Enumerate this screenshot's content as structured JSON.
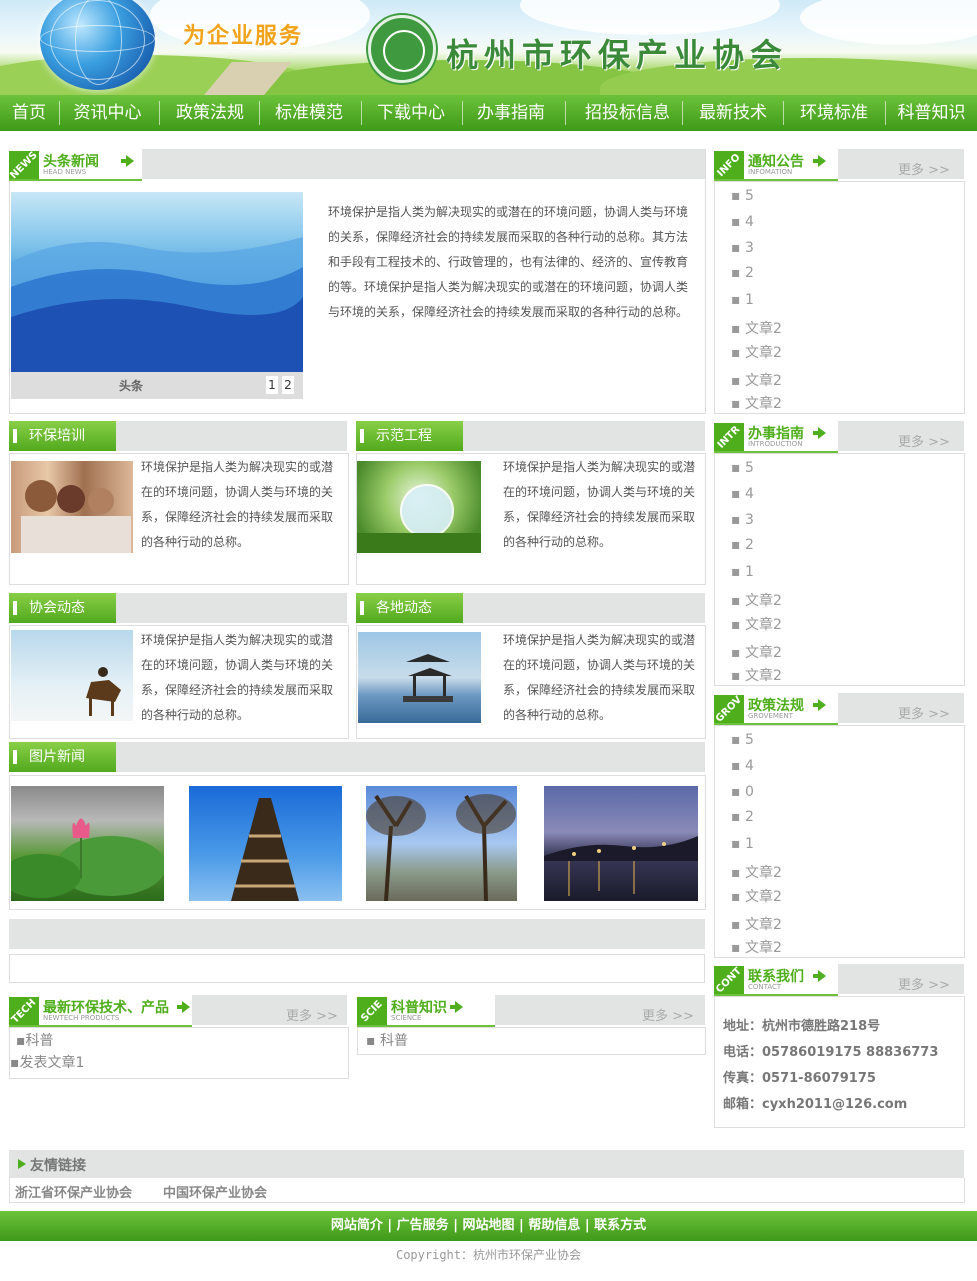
{
  "header": {
    "slogan": "为企业服务",
    "site_name": "杭州市环保产业协会"
  },
  "nav": [
    "首页",
    "资讯中心",
    "政策法规",
    "标准模范",
    "下载中心",
    "办事指南",
    "招投标信息",
    "最新技术",
    "环境标准",
    "科普知识"
  ],
  "headline": {
    "badge": "NEWS",
    "title": "头条新闻",
    "title_en": "HEAD NEWS",
    "caption": "头条",
    "pages": [
      "1",
      "2"
    ],
    "text": "环境保护是指人类为解决现实的或潜在的环境问题，协调人类与环境的关系，保障经济社会的持续发展而采取的各种行动的总称。其方法和手段有工程技术的、行政管理的，也有法律的、经济的、宣传教育的等。环境保护是指人类为解决现实的或潜在的环境问题，协调人类与环境的关系，保障经济社会的持续发展而采取的各种行动的总称。"
  },
  "sections": [
    {
      "title": "环保培训",
      "text": "环境保护是指人类为解决现实的或潜在的环境问题，协调人类与环境的关系，保障经济社会的持续发展而采取的各种行动的总称。"
    },
    {
      "title": "示范工程",
      "text": "环境保护是指人类为解决现实的或潜在的环境问题，协调人类与环境的关系，保障经济社会的持续发展而采取的各种行动的总称。"
    },
    {
      "title": "协会动态",
      "text": "环境保护是指人类为解决现实的或潜在的环境问题，协调人类与环境的关系，保障经济社会的持续发展而采取的各种行动的总称。"
    },
    {
      "title": "各地动态",
      "text": "环境保护是指人类为解决现实的或潜在的环境问题，协调人类与环境的关系，保障经济社会的持续发展而采取的各种行动的总称。"
    }
  ],
  "photo_news": {
    "title": "图片新闻"
  },
  "tech": {
    "badge": "TECH",
    "title": "最新环保技术、产品",
    "title_en": "NEWTECH PRODUCTS",
    "more": "更多 >>",
    "items": [
      "科普",
      "发表文章1"
    ]
  },
  "science": {
    "badge": "SCIE",
    "title": "科普知识",
    "title_en": "SCIENCE",
    "more": "更多 >>",
    "items": [
      "科普"
    ]
  },
  "notice": {
    "badge": "INFO",
    "title": "通知公告",
    "title_en": "INFOMATION",
    "more": "更多 >>",
    "items": [
      "5",
      "4",
      "3",
      "2",
      "1",
      "文章2",
      "文章2",
      "文章2",
      "文章2"
    ]
  },
  "guide": {
    "badge": "INTR",
    "title": "办事指南",
    "title_en": "INTRODUCTION",
    "more": "更多 >>",
    "items": [
      "5",
      "4",
      "3",
      "2",
      "1",
      "文章2",
      "文章2",
      "文章2",
      "文章2"
    ]
  },
  "policy": {
    "badge": "GROV",
    "title": "政策法规",
    "title_en": "GROVEMENT",
    "more": "更多 >>",
    "items": [
      "5",
      "4",
      "0",
      "2",
      "1",
      "文章2",
      "文章2",
      "文章2",
      "文章2"
    ]
  },
  "contact": {
    "badge": "CONT",
    "title": "联系我们",
    "title_en": "CONTACT",
    "more": "更多 >>",
    "lines": [
      "地址：杭州市德胜路218号",
      "电话：05786019175 88836773",
      "传真：0571-86079175",
      "邮箱：cyxh2011@126.com"
    ]
  },
  "friend_links": {
    "title": "友情链接",
    "links": [
      "浙江省环保产业协会",
      "中国环保产业协会"
    ]
  },
  "footer": {
    "links": [
      "网站简介",
      "广告服务",
      "网站地图",
      "帮助信息",
      "联系方式"
    ],
    "copyright": "Copyright：杭州市环保产业协会"
  },
  "colors": {
    "brand_green": "#4fae1c",
    "nav_green": "#5cb22a"
  }
}
